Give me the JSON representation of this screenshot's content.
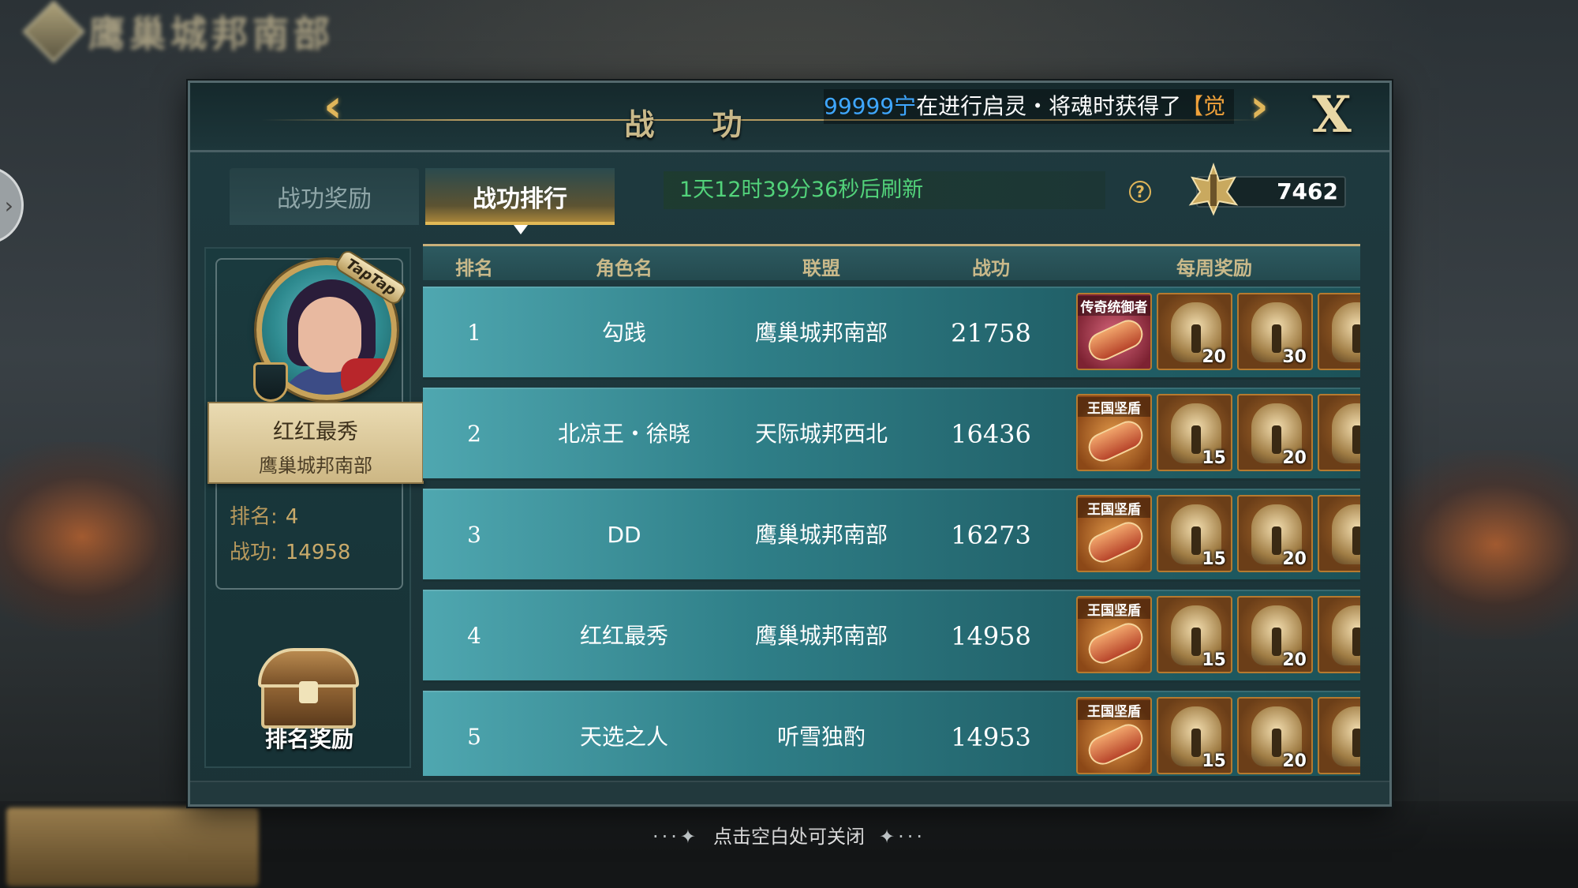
{
  "header": {
    "title": "战 功",
    "marquee": {
      "player": "99999宁",
      "message": "在进行启灵・将魂时获得了",
      "item": "【觉"
    },
    "close_label": "X"
  },
  "tabs": [
    {
      "label": "战功奖励",
      "active": false
    },
    {
      "label": "战功排行",
      "active": true
    }
  ],
  "refresh_timer": "1天12时39分36秒后刷新",
  "help_icon": "?",
  "merit_total": "7462",
  "player": {
    "name": "红红最秀",
    "alliance": "鹰巢城邦南部",
    "badge": "TapTap",
    "rank_label": "排名:",
    "rank_value": "4",
    "merit_label": "战功:",
    "merit_value": "14958"
  },
  "rank_rewards_label": "排名奖励",
  "table": {
    "headers": {
      "rank": "排名",
      "name": "角色名",
      "alliance": "联盟",
      "merit": "战功",
      "reward": "每周奖励"
    },
    "rows": [
      {
        "rank": "1",
        "name": "勾践",
        "alliance": "鹰巢城邦南部",
        "merit": "21758",
        "title_card": "传奇统御者",
        "helm1_qty": "20",
        "helm2_qty": "30"
      },
      {
        "rank": "2",
        "name": "北凉王・徐晓",
        "alliance": "天际城邦西北",
        "merit": "16436",
        "title_card": "王国坚盾",
        "helm1_qty": "15",
        "helm2_qty": "20"
      },
      {
        "rank": "3",
        "name": "DD",
        "alliance": "鹰巢城邦南部",
        "merit": "16273",
        "title_card": "王国坚盾",
        "helm1_qty": "15",
        "helm2_qty": "20"
      },
      {
        "rank": "4",
        "name": "红红最秀",
        "alliance": "鹰巢城邦南部",
        "merit": "14958",
        "title_card": "王国坚盾",
        "helm1_qty": "15",
        "helm2_qty": "20"
      },
      {
        "rank": "5",
        "name": "天选之人",
        "alliance": "听雪独酌",
        "merit": "14953",
        "title_card": "王国坚盾",
        "helm1_qty": "15",
        "helm2_qty": "20"
      }
    ]
  },
  "close_hint": "点击空白处可关闭",
  "background": {
    "title_blurred": "鹰巢城邦南部"
  },
  "colors": {
    "accent_gold": "#c9b98a",
    "timer_green": "#52d27a",
    "marquee_player": "#3fa7ff",
    "marquee_item": "#f0a13a"
  }
}
